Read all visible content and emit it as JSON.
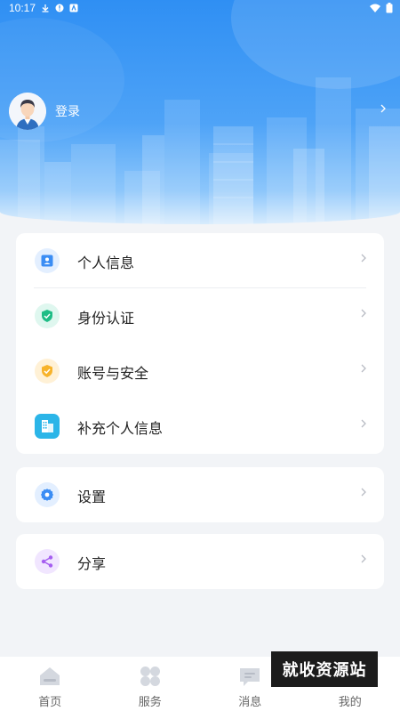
{
  "status_bar": {
    "time": "10:17"
  },
  "profile": {
    "login_label": "登录"
  },
  "menu_group_1": [
    {
      "label": "个人信息",
      "icon": "id-card-icon"
    },
    {
      "label": "身份认证",
      "icon": "shield-check-icon"
    },
    {
      "label": "账号与安全",
      "icon": "shield-lock-icon"
    },
    {
      "label": "补充个人信息",
      "icon": "building-icon"
    }
  ],
  "menu_group_2": [
    {
      "label": "设置",
      "icon": "gear-icon"
    }
  ],
  "menu_group_3": [
    {
      "label": "分享",
      "icon": "share-icon"
    }
  ],
  "bottom_nav": [
    {
      "label": "首页",
      "icon": "home-icon"
    },
    {
      "label": "服务",
      "icon": "grid-icon"
    },
    {
      "label": "消息",
      "icon": "message-icon"
    },
    {
      "label": "我的",
      "icon": "user-icon"
    }
  ],
  "watermark": "就收资源站",
  "colors": {
    "header_blue": "#2f8ff3",
    "id_card_icon_bg": "#e3efff",
    "shield_check_icon_bg": "#dff7ef",
    "shield_lock_icon_bg": "#fff1d6",
    "building_icon_bg": "#d8f1fb",
    "gear_icon_bg": "#e3efff",
    "share_icon_bg": "#f1e6ff"
  }
}
